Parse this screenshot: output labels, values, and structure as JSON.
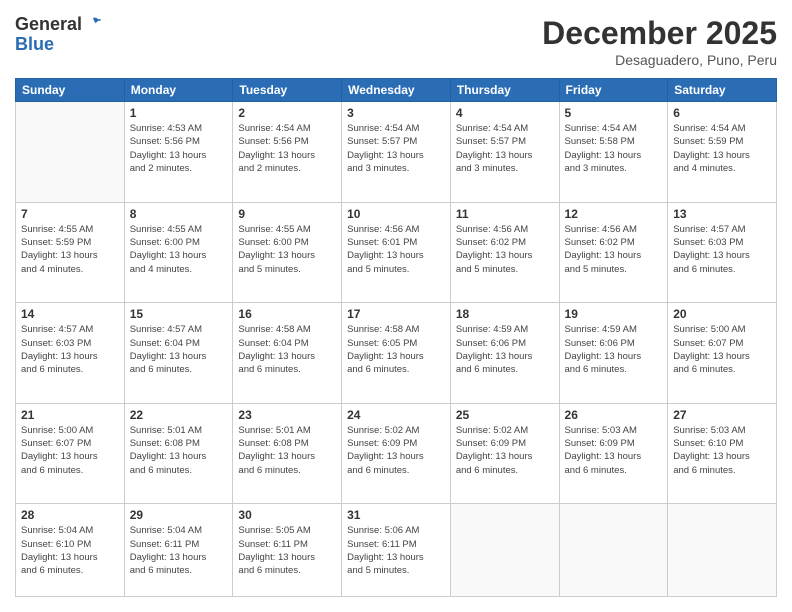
{
  "header": {
    "logo_general": "General",
    "logo_blue": "Blue",
    "month_title": "December 2025",
    "location": "Desaguadero, Puno, Peru"
  },
  "days_of_week": [
    "Sunday",
    "Monday",
    "Tuesday",
    "Wednesday",
    "Thursday",
    "Friday",
    "Saturday"
  ],
  "weeks": [
    [
      {
        "day": "",
        "info": ""
      },
      {
        "day": "1",
        "info": "Sunrise: 4:53 AM\nSunset: 5:56 PM\nDaylight: 13 hours\nand 2 minutes."
      },
      {
        "day": "2",
        "info": "Sunrise: 4:54 AM\nSunset: 5:56 PM\nDaylight: 13 hours\nand 2 minutes."
      },
      {
        "day": "3",
        "info": "Sunrise: 4:54 AM\nSunset: 5:57 PM\nDaylight: 13 hours\nand 3 minutes."
      },
      {
        "day": "4",
        "info": "Sunrise: 4:54 AM\nSunset: 5:57 PM\nDaylight: 13 hours\nand 3 minutes."
      },
      {
        "day": "5",
        "info": "Sunrise: 4:54 AM\nSunset: 5:58 PM\nDaylight: 13 hours\nand 3 minutes."
      },
      {
        "day": "6",
        "info": "Sunrise: 4:54 AM\nSunset: 5:59 PM\nDaylight: 13 hours\nand 4 minutes."
      }
    ],
    [
      {
        "day": "7",
        "info": "Sunrise: 4:55 AM\nSunset: 5:59 PM\nDaylight: 13 hours\nand 4 minutes."
      },
      {
        "day": "8",
        "info": "Sunrise: 4:55 AM\nSunset: 6:00 PM\nDaylight: 13 hours\nand 4 minutes."
      },
      {
        "day": "9",
        "info": "Sunrise: 4:55 AM\nSunset: 6:00 PM\nDaylight: 13 hours\nand 5 minutes."
      },
      {
        "day": "10",
        "info": "Sunrise: 4:56 AM\nSunset: 6:01 PM\nDaylight: 13 hours\nand 5 minutes."
      },
      {
        "day": "11",
        "info": "Sunrise: 4:56 AM\nSunset: 6:02 PM\nDaylight: 13 hours\nand 5 minutes."
      },
      {
        "day": "12",
        "info": "Sunrise: 4:56 AM\nSunset: 6:02 PM\nDaylight: 13 hours\nand 5 minutes."
      },
      {
        "day": "13",
        "info": "Sunrise: 4:57 AM\nSunset: 6:03 PM\nDaylight: 13 hours\nand 6 minutes."
      }
    ],
    [
      {
        "day": "14",
        "info": "Sunrise: 4:57 AM\nSunset: 6:03 PM\nDaylight: 13 hours\nand 6 minutes."
      },
      {
        "day": "15",
        "info": "Sunrise: 4:57 AM\nSunset: 6:04 PM\nDaylight: 13 hours\nand 6 minutes."
      },
      {
        "day": "16",
        "info": "Sunrise: 4:58 AM\nSunset: 6:04 PM\nDaylight: 13 hours\nand 6 minutes."
      },
      {
        "day": "17",
        "info": "Sunrise: 4:58 AM\nSunset: 6:05 PM\nDaylight: 13 hours\nand 6 minutes."
      },
      {
        "day": "18",
        "info": "Sunrise: 4:59 AM\nSunset: 6:06 PM\nDaylight: 13 hours\nand 6 minutes."
      },
      {
        "day": "19",
        "info": "Sunrise: 4:59 AM\nSunset: 6:06 PM\nDaylight: 13 hours\nand 6 minutes."
      },
      {
        "day": "20",
        "info": "Sunrise: 5:00 AM\nSunset: 6:07 PM\nDaylight: 13 hours\nand 6 minutes."
      }
    ],
    [
      {
        "day": "21",
        "info": "Sunrise: 5:00 AM\nSunset: 6:07 PM\nDaylight: 13 hours\nand 6 minutes."
      },
      {
        "day": "22",
        "info": "Sunrise: 5:01 AM\nSunset: 6:08 PM\nDaylight: 13 hours\nand 6 minutes."
      },
      {
        "day": "23",
        "info": "Sunrise: 5:01 AM\nSunset: 6:08 PM\nDaylight: 13 hours\nand 6 minutes."
      },
      {
        "day": "24",
        "info": "Sunrise: 5:02 AM\nSunset: 6:09 PM\nDaylight: 13 hours\nand 6 minutes."
      },
      {
        "day": "25",
        "info": "Sunrise: 5:02 AM\nSunset: 6:09 PM\nDaylight: 13 hours\nand 6 minutes."
      },
      {
        "day": "26",
        "info": "Sunrise: 5:03 AM\nSunset: 6:09 PM\nDaylight: 13 hours\nand 6 minutes."
      },
      {
        "day": "27",
        "info": "Sunrise: 5:03 AM\nSunset: 6:10 PM\nDaylight: 13 hours\nand 6 minutes."
      }
    ],
    [
      {
        "day": "28",
        "info": "Sunrise: 5:04 AM\nSunset: 6:10 PM\nDaylight: 13 hours\nand 6 minutes."
      },
      {
        "day": "29",
        "info": "Sunrise: 5:04 AM\nSunset: 6:11 PM\nDaylight: 13 hours\nand 6 minutes."
      },
      {
        "day": "30",
        "info": "Sunrise: 5:05 AM\nSunset: 6:11 PM\nDaylight: 13 hours\nand 6 minutes."
      },
      {
        "day": "31",
        "info": "Sunrise: 5:06 AM\nSunset: 6:11 PM\nDaylight: 13 hours\nand 5 minutes."
      },
      {
        "day": "",
        "info": ""
      },
      {
        "day": "",
        "info": ""
      },
      {
        "day": "",
        "info": ""
      }
    ]
  ]
}
